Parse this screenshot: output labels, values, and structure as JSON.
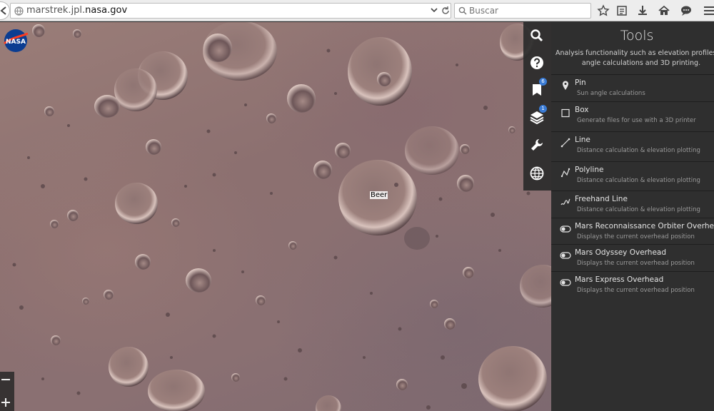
{
  "browser": {
    "url_prefix": "marstrek.jpl.",
    "url_domain": "nasa.gov",
    "search_placeholder": "Buscar"
  },
  "map": {
    "logo_text": "NASA",
    "crater_label": "Beer"
  },
  "rail": {
    "bookmarks_badge": "6",
    "layers_badge": "1"
  },
  "panel": {
    "title": "Tools",
    "description_line1": "Analysis functionality such as elevation profiles, sun",
    "description_line2": "angle calculations and 3D printing.",
    "tools": [
      {
        "name": "Pin",
        "desc": "Sun angle calculations",
        "icon": "pin-icon"
      },
      {
        "name": "Box",
        "desc": "Generate files for use with a 3D printer",
        "icon": "box-icon"
      },
      {
        "name": "Line",
        "desc": "Distance calculation & elevation plotting",
        "icon": "line-icon"
      },
      {
        "name": "Polyline",
        "desc": "Distance calculation & elevation plotting",
        "icon": "polyline-icon"
      },
      {
        "name": "Freehand Line",
        "desc": "Distance calculation & elevation plotting",
        "icon": "freehand-icon"
      },
      {
        "name": "Mars Reconnaissance Orbiter Overhead",
        "desc": "Displays the current overhead position",
        "icon": "toggle-icon"
      },
      {
        "name": "Mars Odyssey Overhead",
        "desc": "Displays the current overhead position",
        "icon": "toggle-icon"
      },
      {
        "name": "Mars Express Overhead",
        "desc": "Displays the current overhead position",
        "icon": "toggle-icon"
      }
    ]
  }
}
